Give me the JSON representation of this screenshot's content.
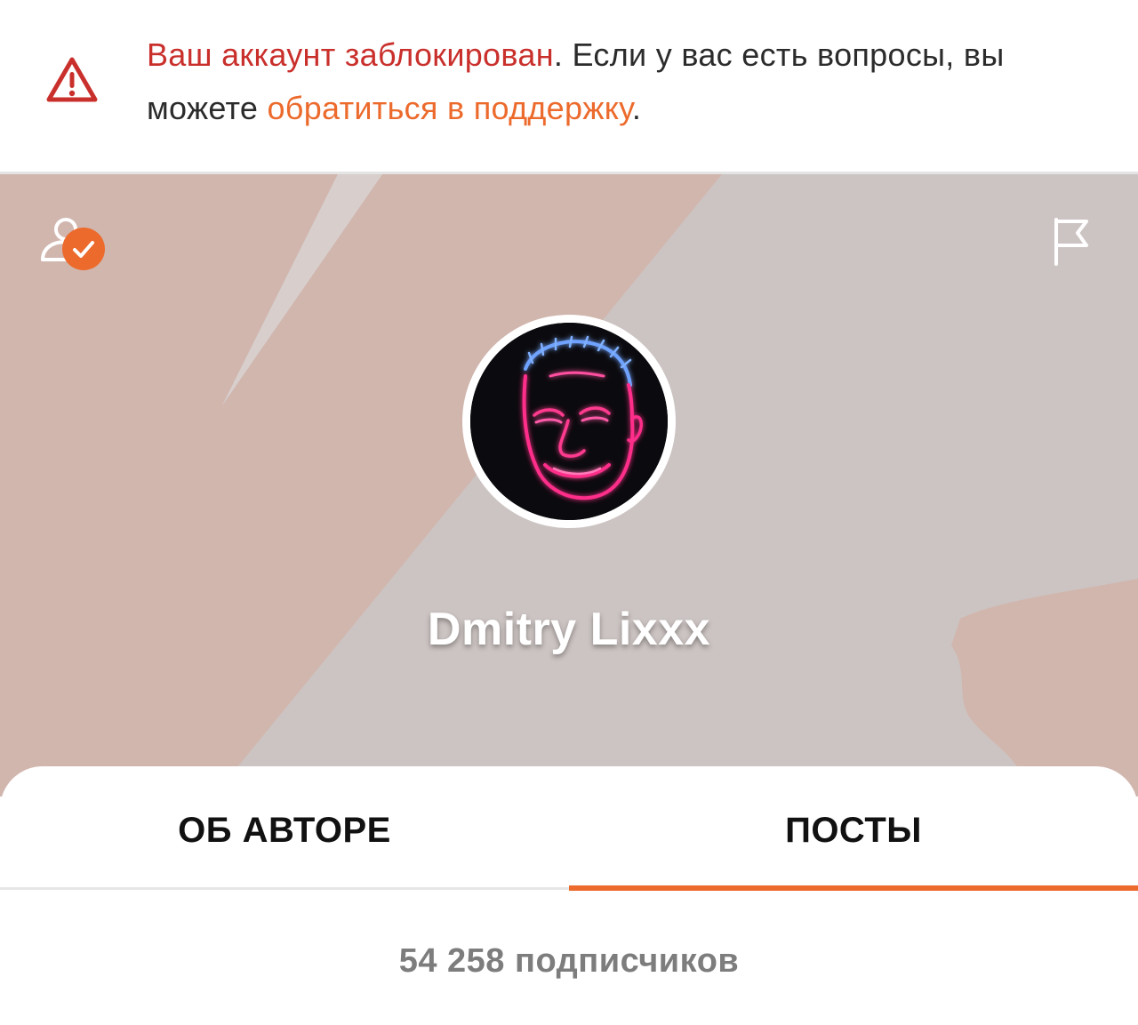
{
  "banner": {
    "icon": "warning-triangle-icon",
    "blocked_text": "Ваш аккаунт заблокирован",
    "text_middle": ". Если у вас есть вопросы, вы можете ",
    "support_link": "обратиться в поддержку",
    "text_end": ".",
    "colors": {
      "alert": "#c9302c",
      "link": "#ec6a2c"
    }
  },
  "header": {
    "subscribe_icon": "user-check-icon",
    "report_icon": "flag-icon",
    "accent": "#ec6a2c"
  },
  "profile": {
    "avatar": "author-avatar",
    "name": "Dmitry Lixxx"
  },
  "tabs": [
    {
      "label": "ОБ АВТОРЕ",
      "active": false
    },
    {
      "label": "ПОСТЫ",
      "active": true
    }
  ],
  "stats": {
    "subscribers": "54 258 подписчиков"
  }
}
